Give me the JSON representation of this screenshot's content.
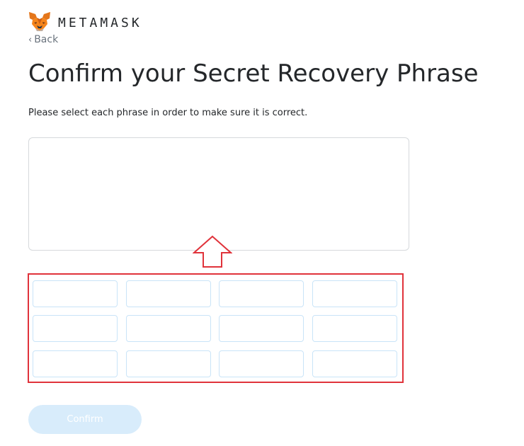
{
  "header": {
    "logo_text": "METAMASK",
    "logo_icon": "metamask-fox-icon",
    "back_label": "Back",
    "back_icon": "chevron-left-icon"
  },
  "main": {
    "title": "Confirm your Secret Recovery Phrase",
    "instruction": "Please select each phrase in order to make sure it is correct.",
    "hint_arrow_icon": "arrow-up-icon",
    "word_chips": [
      "",
      "",
      "",
      "",
      "",
      "",
      "",
      "",
      "",
      "",
      "",
      ""
    ],
    "confirm_label": "Confirm"
  },
  "colors": {
    "highlight_border": "#e0333b",
    "chip_border": "#c9e4f8",
    "button_disabled_bg": "#d8ecfb",
    "box_border": "#d6d9dc"
  }
}
